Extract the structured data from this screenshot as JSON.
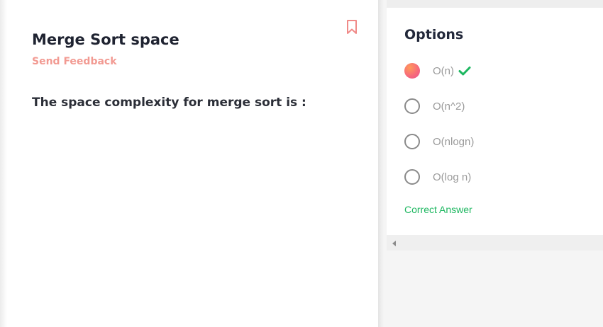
{
  "question": {
    "title": "Merge Sort space",
    "feedback_label": "Send Feedback",
    "text": "The space complexity for merge sort is :"
  },
  "options_panel": {
    "title": "Options",
    "options": [
      {
        "label": "O(n)",
        "selected": true,
        "correct": true
      },
      {
        "label": "O(n^2)",
        "selected": false,
        "correct": false
      },
      {
        "label": "O(nlogn)",
        "selected": false,
        "correct": false
      },
      {
        "label": "O(log n)",
        "selected": false,
        "correct": false
      }
    ],
    "result_label": "Correct Answer"
  },
  "colors": {
    "accent_feedback": "#f29a92",
    "correct_green": "#1db760",
    "bookmark": "#f08a88"
  },
  "icons": [
    "bookmark-icon",
    "checkmark-icon",
    "scroll-left-arrow-icon"
  ]
}
